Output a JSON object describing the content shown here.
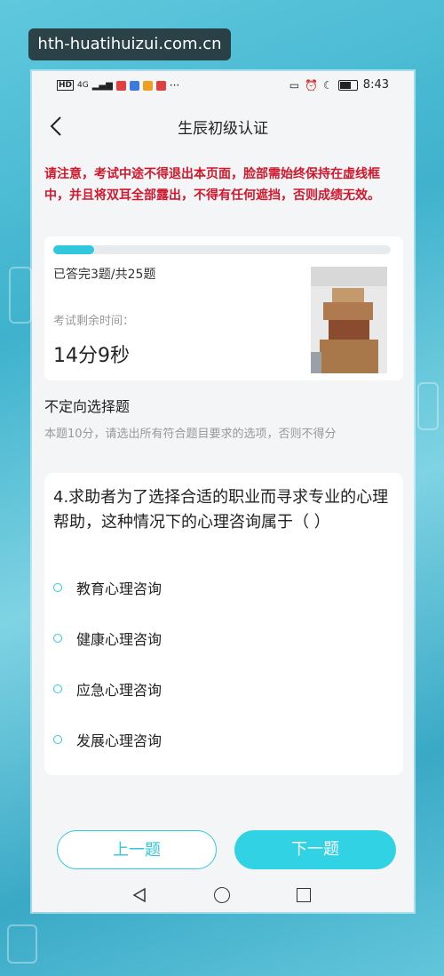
{
  "watermark": "hth-huatihuizui.com.cn",
  "status_bar": {
    "time": "8:43",
    "left_text": "HD",
    "network": "4G"
  },
  "header": {
    "title": "生辰初级认证"
  },
  "notice": "请注意，考试中途不得退出本页面，脸部需始终保持在虚线框中，并且将双耳全部露出，不得有任何遮挡，否则成绩无效。",
  "progress": {
    "answered_text": "已答完3题/共25题",
    "fraction": 0.12
  },
  "timer": {
    "label": "考试剩余时间：",
    "value": "14分9秒"
  },
  "question": {
    "type": "不定向选择题",
    "description": "本题10分，请选出所有符合题目要求的选项，否则不得分",
    "text": "4.求助者为了选择合适的职业而寻求专业的心理帮助，这种情况下的心理咨询属于（  ）",
    "options": [
      "教育心理咨询",
      "健康心理咨询",
      "应急心理咨询",
      "发展心理咨询"
    ]
  },
  "buttons": {
    "prev": "上一题",
    "next": "下一题"
  },
  "colors": {
    "accent": "#31c7dd",
    "notice": "#d0182c"
  }
}
